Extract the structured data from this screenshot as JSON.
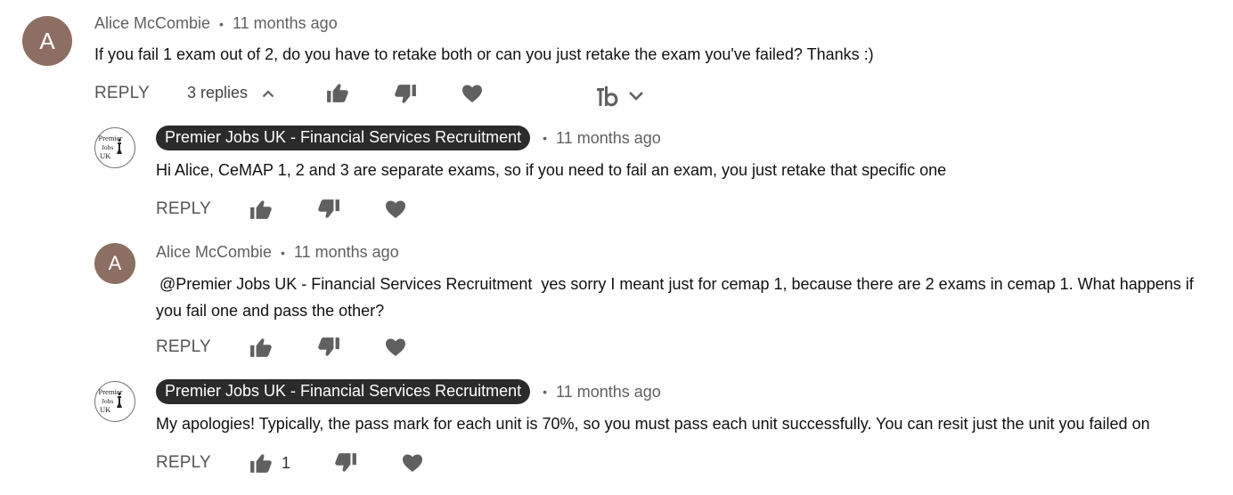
{
  "colors": {
    "avatar_brown": "#8d6e63",
    "chip_background": "#2b2b2b",
    "muted_text": "#606060",
    "icon_gray": "#606060"
  },
  "main_comment": {
    "avatar_letter": "A",
    "author": "Alice McCombie",
    "separator": "•",
    "timestamp": "11 months ago",
    "text": "If you fail 1 exam out of 2, do you have to retake both or can you just retake the exam you've failed? Thanks :)",
    "reply_label": "REPLY",
    "replies_toggle_label": "3 replies",
    "icons": [
      "thumbs-up-icon",
      "thumbs-down-icon",
      "heart-icon",
      "tubebuddy-icon",
      "chevron-down-icon",
      "chevron-up-icon"
    ]
  },
  "replies": [
    {
      "avatar": "logo",
      "avatar_text": [
        "Premier",
        "Jobs",
        "UK"
      ],
      "author": "Premier Jobs UK - Financial Services Recruitment",
      "separator": "•",
      "timestamp": "11 months ago",
      "text": "Hi Alice, CeMAP 1, 2 and 3 are separate exams, so if you need to fail an exam, you just retake that specific one",
      "reply_label": "REPLY",
      "like_count": ""
    },
    {
      "avatar": "letter",
      "avatar_letter": "A",
      "author": "Alice McCombie",
      "separator": "•",
      "timestamp": "11 months ago",
      "text_line1": "@Premier Jobs UK - Financial Services Recruitment  yes sorry I meant just for cemap 1, because there are 2 exams in cemap 1. What happens if",
      "text_line2": "you fail one and pass the other?",
      "reply_label": "REPLY",
      "like_count": ""
    },
    {
      "avatar": "logo",
      "avatar_text": [
        "Premier",
        "Jobs",
        "UK"
      ],
      "author": "Premier Jobs UK - Financial Services Recruitment",
      "separator": "•",
      "timestamp": "11 months ago",
      "text": "My apologies! Typically, the pass mark for each unit is 70%, so you must pass each unit successfully. You can resit just the unit you failed on",
      "reply_label": "REPLY",
      "like_count": "1"
    }
  ]
}
